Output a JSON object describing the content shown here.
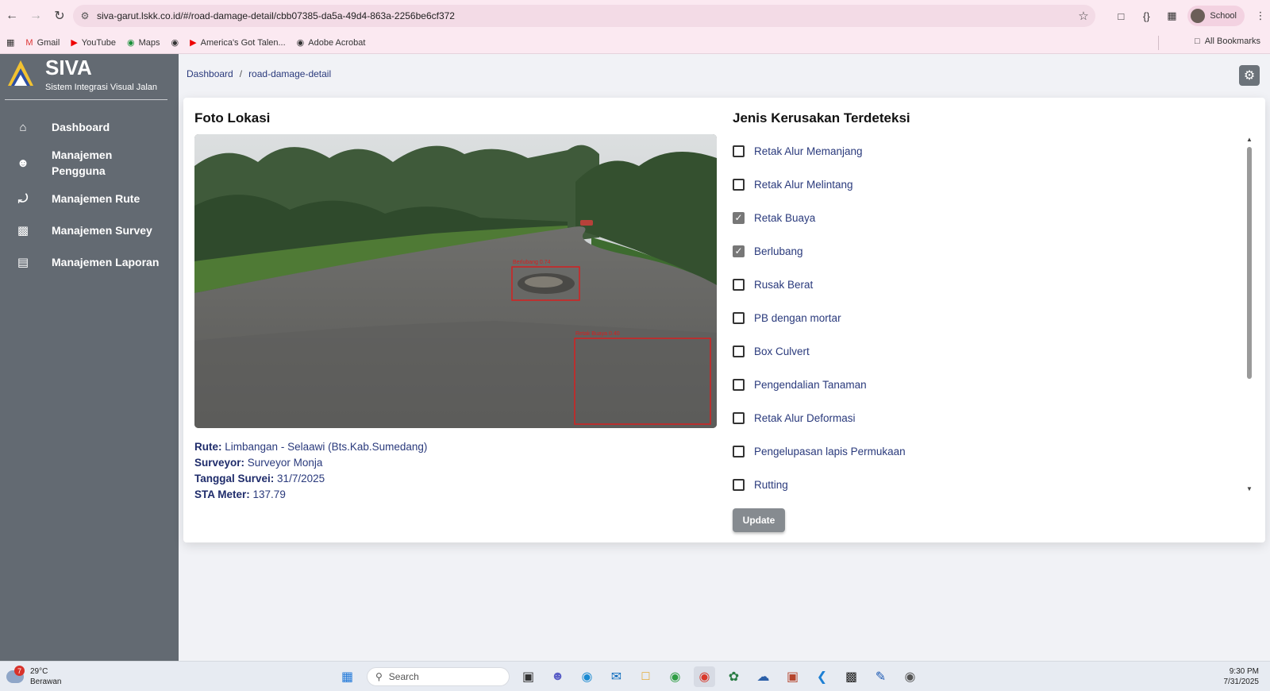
{
  "browser": {
    "url": "siva-garut.lskk.co.id/#/road-damage-detail/cbb07385-da5a-49d4-863a-2256be6cf372",
    "profile_label": "School",
    "bookmarks": [
      "Gmail",
      "YouTube",
      "Maps",
      "America's Got Talen...",
      "Adobe Acrobat"
    ],
    "all_bookmarks_label": "All Bookmarks"
  },
  "sidebar": {
    "brand": "SIVA",
    "brand_sub": "Sistem Integrasi Visual Jalan",
    "items": [
      {
        "label": "Dashboard",
        "icon": "home-icon"
      },
      {
        "label": "Manajemen Pengguna",
        "icon": "users-icon"
      },
      {
        "label": "Manajemen Rute",
        "icon": "route-icon"
      },
      {
        "label": "Manajemen Survey",
        "icon": "chart-icon"
      },
      {
        "label": "Manajemen Laporan",
        "icon": "report-icon"
      }
    ]
  },
  "breadcrumb": {
    "home": "Dashboard",
    "current": "road-damage-detail"
  },
  "photo_section": {
    "title": "Foto Lokasi",
    "detections": [
      {
        "label": "Berlubang 0.74"
      },
      {
        "label": "Retak Buaya 0.40"
      }
    ]
  },
  "info": {
    "rute_key": "Rute:",
    "rute_val": "Limbangan - Selaawi (Bts.Kab.Sumedang)",
    "surveyor_key": "Surveyor:",
    "surveyor_val": "Surveyor Monja",
    "tanggal_key": "Tanggal Survei:",
    "tanggal_val": "31/7/2025",
    "sta_key": "STA Meter:",
    "sta_val": "137.79"
  },
  "damage_section": {
    "title": "Jenis Kerusakan Terdeteksi",
    "items": [
      {
        "label": "Retak Alur Memanjang",
        "checked": false
      },
      {
        "label": "Retak Alur Melintang",
        "checked": false
      },
      {
        "label": "Retak Buaya",
        "checked": true
      },
      {
        "label": "Berlubang",
        "checked": true
      },
      {
        "label": "Rusak Berat",
        "checked": false
      },
      {
        "label": "PB dengan mortar",
        "checked": false
      },
      {
        "label": "Box Culvert",
        "checked": false
      },
      {
        "label": "Pengendalian Tanaman",
        "checked": false
      },
      {
        "label": "Retak Alur Deformasi",
        "checked": false
      },
      {
        "label": "Pengelupasan lapis Permukaan",
        "checked": false
      },
      {
        "label": "Rutting",
        "checked": false
      }
    ],
    "update_label": "Update"
  },
  "taskbar": {
    "weather_temp": "29°C",
    "weather_desc": "Berawan",
    "weather_badge": "7",
    "search_label": "Search",
    "time": "9:30 PM",
    "date": "7/31/2025"
  }
}
